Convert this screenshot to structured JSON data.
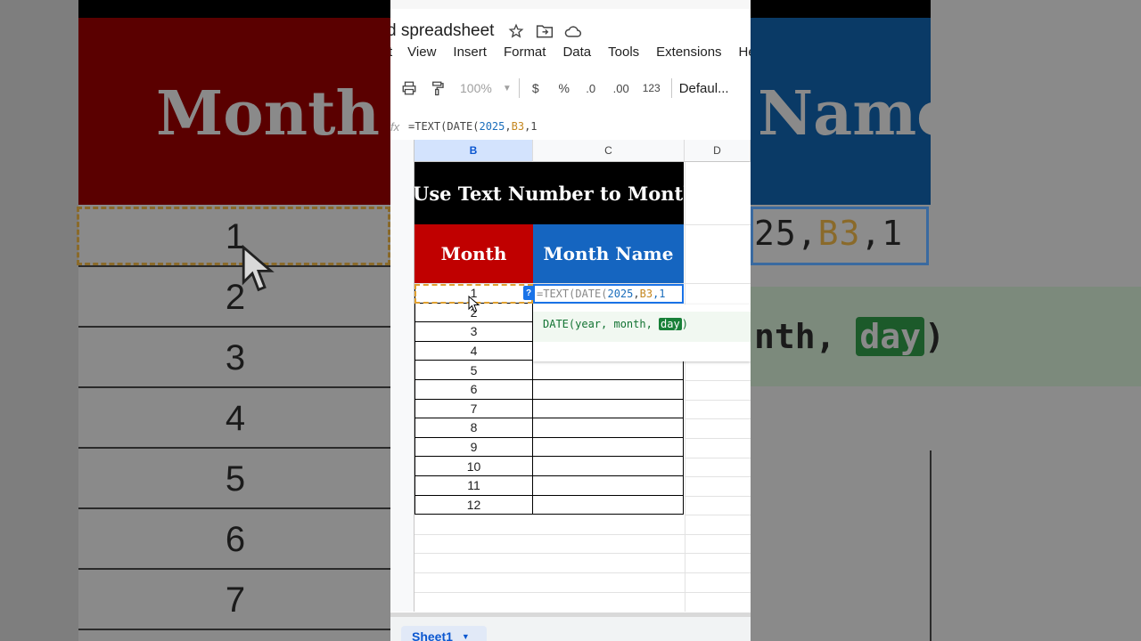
{
  "background": {
    "header_month": "Month",
    "header_name": "Name",
    "formula_fragment_num": "25",
    "formula_fragment_ref": "B3",
    "formula_fragment_tail": ",1",
    "hint_fragment": "nth,",
    "hint_day": "day",
    "hint_close": ")",
    "numbers": [
      "1",
      "2",
      "3",
      "4",
      "5",
      "6",
      "7"
    ]
  },
  "window": {
    "doc_title": "d spreadsheet",
    "menu": [
      "t",
      "View",
      "Insert",
      "Format",
      "Data",
      "Tools",
      "Extensions",
      "Help"
    ],
    "toolbar": {
      "zoom": "100%",
      "currency": "$",
      "percent": "%",
      "decrease_decimal": ".0",
      "increase_decimal": ".00",
      "number_format": "123",
      "font": "Defaul..."
    },
    "formula_bar": {
      "fx": "fx",
      "prefix": "=TEXT(DATE(",
      "num": "2025",
      "sep": ",",
      "ref": "B3",
      "tail": ",1"
    },
    "columns": [
      "B",
      "C",
      "D"
    ]
  },
  "sheet": {
    "title": "Use Text Number to Month",
    "header_month": "Month",
    "header_month_name": "Month Name",
    "months": [
      "1",
      "2",
      "3",
      "4",
      "5",
      "6",
      "7",
      "8",
      "9",
      "10",
      "11",
      "12"
    ],
    "editing": {
      "fn": "=TEXT(DATE(",
      "num": "2025",
      "sep": ",",
      "ref": "B3",
      "tail": ",1",
      "badge": "?"
    },
    "hint": {
      "sig": "DATE(year, month, ",
      "active_arg": "day",
      "close": ")"
    },
    "tab": "Sheet1"
  },
  "colors": {
    "header_red": "#c00000",
    "header_blue": "#1565c0",
    "title_bg": "#000000",
    "selection_blue": "#1a73e8",
    "hint_green": "#188038"
  }
}
